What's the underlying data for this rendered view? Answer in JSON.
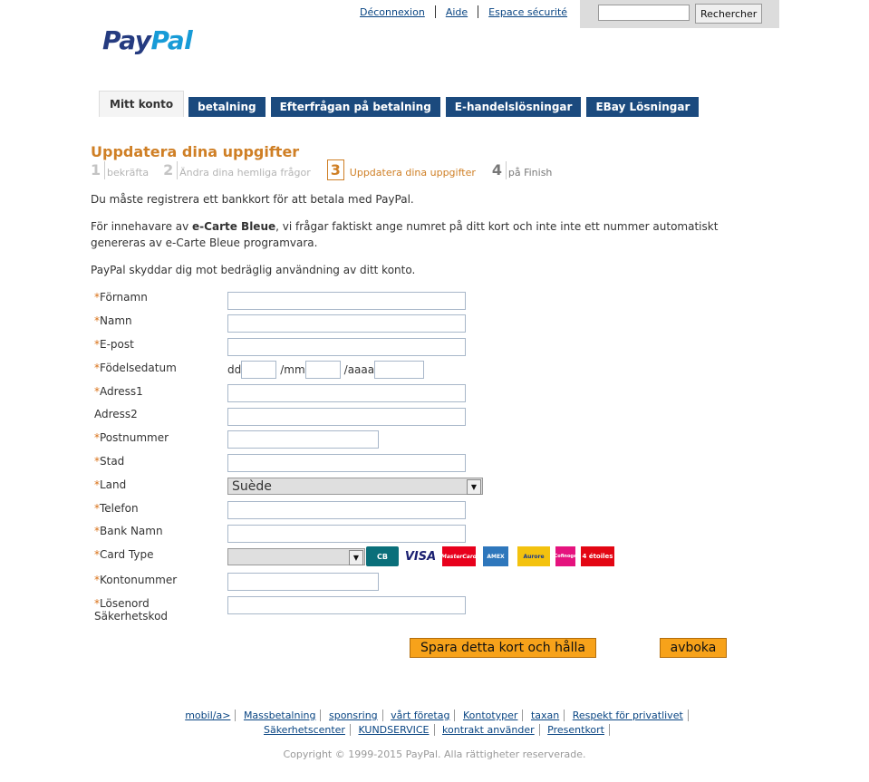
{
  "header": {
    "links": [
      "Déconnexion",
      "Aide",
      "Espace sécurité"
    ],
    "search_placeholder": "",
    "search_button": "Rechercher",
    "logo_pay": "Pay",
    "logo_pal": "Pal"
  },
  "tabs": {
    "active": "Mitt konto",
    "items": [
      "betalning",
      "Efterfrågan på betalning",
      "E-handelslösningar",
      "EBay Lösningar"
    ]
  },
  "page_title": "Uppdatera dina uppgifter",
  "steps": [
    {
      "num": "1",
      "label": "bekräfta"
    },
    {
      "num": "2",
      "label": "Ändra dina hemliga frågor"
    },
    {
      "num": "3",
      "label": "Uppdatera dina uppgifter"
    },
    {
      "num": "4",
      "label": "på Finish"
    }
  ],
  "messages": {
    "m1": "Du måste registrera ett bankkort för att betala med PayPal.",
    "m2_pre": "För innehavare av ",
    "m2_bold": "e-Carte Bleue",
    "m2_post": ", vi frågar faktiskt ange numret på ditt kort och inte inte ett nummer automatiskt genereras av e-Carte Bleue programvara.",
    "m3": "PayPal skyddar dig mot bedräglig användning av ditt konto."
  },
  "form": {
    "required_mark": "*",
    "fornamn": "Förnamn",
    "namn": "Namn",
    "epost": "E-post",
    "fodelsedatum": "Födelsedatum",
    "dd": "dd",
    "mm": "/mm",
    "aaaa": "/aaaa",
    "adress1": "Adress1",
    "adress2": "Adress2",
    "postnummer": "Postnummer",
    "stad": "Stad",
    "land": "Land",
    "land_value": "Suède",
    "telefon": "Telefon",
    "bank_namn": "Bank Namn",
    "card_type": "Card Type",
    "card_logos": [
      "CB",
      "VISA",
      "MasterCard",
      "AMEX",
      "Aurore",
      "Cofinoga",
      "4 étoiles"
    ],
    "kontonummer": "Kontonummer",
    "losenord": "Lösenord",
    "sakerhetskod": "Säkerhetskod"
  },
  "buttons": {
    "save": "Spara detta kort och hålla",
    "cancel": "avboka"
  },
  "footer": {
    "row1": [
      "mobil/a>",
      "Massbetalning",
      "sponsring",
      "vårt företag",
      "Kontotyper",
      "taxan",
      "Respekt för privatlivet"
    ],
    "row2": [
      "Säkerhetscenter",
      "KUNDSERVICE",
      "kontrakt använder",
      "Presentkort"
    ],
    "copyright": "Copyright © 1999-2015 PayPal. Alla rättigheter reserverade."
  },
  "colors": {
    "accent": "#cf7f25",
    "tab_bg": "#1b4a7e",
    "button": "#f7a21a",
    "link": "#084482"
  }
}
